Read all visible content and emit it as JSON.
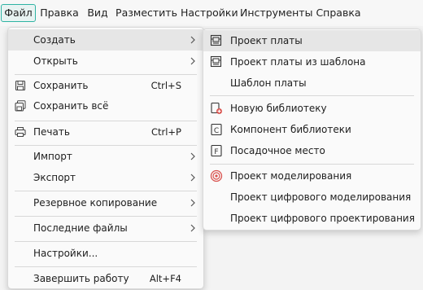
{
  "menubar": {
    "items": [
      {
        "label": "Файл"
      },
      {
        "label": "Правка"
      },
      {
        "label": "Вид"
      },
      {
        "label": "Разместить"
      },
      {
        "label": "Настройки"
      },
      {
        "label": "Инструменты"
      },
      {
        "label": "Справка"
      }
    ]
  },
  "file_menu": {
    "create": "Создать",
    "open": "Открыть",
    "save": {
      "label": "Сохранить",
      "shortcut": "Ctrl+S"
    },
    "save_all": "Сохранить всё",
    "print": {
      "label": "Печать",
      "shortcut": "Ctrl+P"
    },
    "import": "Импорт",
    "export": "Экспорт",
    "backup": "Резервное копирование",
    "recent": "Последние файлы",
    "settings": "Настройки...",
    "exit": {
      "label": "Завершить работу",
      "shortcut": "Alt+F4"
    }
  },
  "create_submenu": {
    "board_project": "Проект платы",
    "board_from_template": "Проект платы из шаблона",
    "board_template": "Шаблон платы",
    "new_library": "Новую библиотеку",
    "library_component": "Компонент библиотеки",
    "footprint": "Посадочное место",
    "simulation_project": "Проект моделирования",
    "digital_simulation_project": "Проект цифрового моделирования",
    "digital_design_project": "Проект цифрового проектирования"
  },
  "colors": {
    "accent": "#2fb3a3",
    "highlight": "#e6e6e6",
    "icon_red": "#d9534f"
  }
}
